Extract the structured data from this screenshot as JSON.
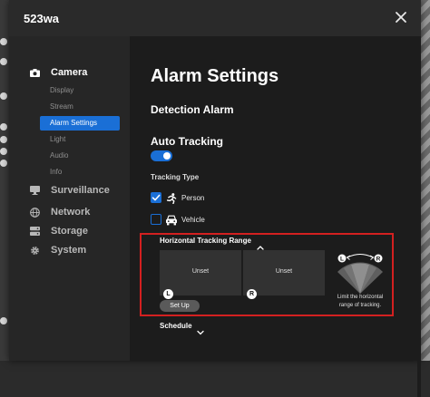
{
  "window": {
    "title": "523wa",
    "close_icon": "close-icon"
  },
  "sidebar": {
    "items": [
      {
        "label": "Camera",
        "icon": "camera-icon",
        "active": true
      },
      {
        "label": "Surveillance",
        "icon": "monitor-icon",
        "active": false
      },
      {
        "label": "Network",
        "icon": "globe-icon",
        "active": false
      },
      {
        "label": "Storage",
        "icon": "storage-icon",
        "active": false
      },
      {
        "label": "System",
        "icon": "gear-icon",
        "active": false
      }
    ],
    "camera_subitems": [
      {
        "label": "Display",
        "active": false
      },
      {
        "label": "Stream",
        "active": false
      },
      {
        "label": "Alarm Settings",
        "active": true
      },
      {
        "label": "Light",
        "active": false
      },
      {
        "label": "Audio",
        "active": false
      },
      {
        "label": "Info",
        "active": false
      }
    ]
  },
  "main": {
    "page_title": "Alarm Settings",
    "section_title": "Detection Alarm",
    "auto_tracking": {
      "label": "Auto Tracking",
      "enabled": true
    },
    "tracking_type": {
      "label": "Tracking Type",
      "options": [
        {
          "label": "Person",
          "checked": true,
          "icon": "person-running-icon"
        },
        {
          "label": "Vehicle",
          "checked": false,
          "icon": "car-icon"
        }
      ]
    },
    "horizontal_range": {
      "label": "Horizontal Tracking Range",
      "left_pane": {
        "value": "Unset",
        "badge": "L"
      },
      "right_pane": {
        "value": "Unset",
        "badge": "R"
      },
      "setup_button": "Set Up",
      "diagram_left": "L",
      "diagram_right": "R",
      "hint": "Limit the horizontal range of tracking."
    },
    "schedule": {
      "label": "Schedule"
    }
  },
  "colors": {
    "accent": "#1a6fd6",
    "highlight_border": "#d32020",
    "dialog_bg": "#1c1c1c",
    "sidebar_bg": "#262626"
  }
}
